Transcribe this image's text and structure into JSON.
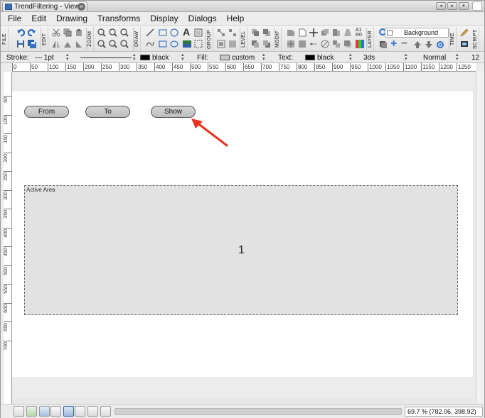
{
  "window": {
    "tab_title": "TrendFiltering - View1",
    "close_glyph": "×",
    "buttons": [
      "◂",
      "▸",
      "▾"
    ]
  },
  "menu": [
    "File",
    "Edit",
    "Drawing",
    "Transforms",
    "Display",
    "Dialogs",
    "Help"
  ],
  "toolbar": {
    "group_labels": [
      "FILE",
      "EDIT",
      "ZOOM",
      "DRAW",
      "GROUP",
      "LEVEL",
      "MODIF",
      "LAYER",
      "TIME",
      "SCRIPT"
    ],
    "layer_name": "Background",
    "modif_text_a": "A1",
    "modif_text_b": "R0",
    "text_icon": "A"
  },
  "props": {
    "stroke_label": "Stroke:",
    "stroke_width": "1pt",
    "stroke_color": "black",
    "fill_label": "Fill:",
    "fill_value": "custom",
    "text_label": "Text:",
    "text_color": "black",
    "text_font": "3ds",
    "text_style": "Normal",
    "text_size": "12"
  },
  "ruler": {
    "h": [
      "0",
      "50",
      "100",
      "150",
      "200",
      "250",
      "300",
      "350",
      "400",
      "450",
      "500",
      "550",
      "600",
      "650",
      "700",
      "750",
      "800",
      "850",
      "900",
      "950",
      "1000",
      "1050",
      "1100",
      "1150",
      "1200",
      "1250"
    ],
    "v": [
      "50",
      "100",
      "150",
      "200",
      "250",
      "300",
      "350",
      "400",
      "450",
      "500",
      "550",
      "600",
      "650",
      "700"
    ]
  },
  "canvas": {
    "buttons": [
      "From",
      "To",
      "Show"
    ],
    "active_area_label": "Active Area",
    "active_area_value": "1"
  },
  "status": {
    "zoom_readout": "69.7 % (782.06, 398.92)",
    "progress": 0
  },
  "colors": {
    "annotation_arrow": "#e8321f",
    "layer_eye": "#2f6fd1"
  }
}
